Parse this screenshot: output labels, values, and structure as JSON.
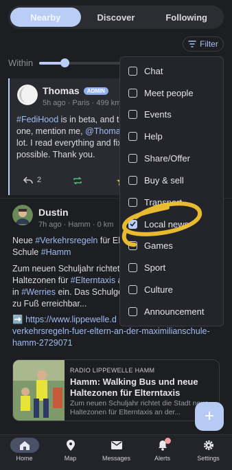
{
  "tabs": [
    {
      "label": "Nearby",
      "active": true
    },
    {
      "label": "Discover",
      "active": false
    },
    {
      "label": "Following",
      "active": false
    }
  ],
  "filter": {
    "label": "Filter"
  },
  "within": {
    "label": "Within",
    "slider_value_fraction": 0.3
  },
  "post1": {
    "author": "Thomas",
    "badge": "ADMIN",
    "meta": "5h ago · Paris · 499 km",
    "line1_tag": "#FediHood",
    "line1_rest": " is in beta, and th",
    "line2_pre": "one, mention me, ",
    "line2_mention": "@Thomas",
    "line3": "lot. I read everything and fix",
    "line4": "possible. Thank you.",
    "replies": "2"
  },
  "post2": {
    "author": "Dustin",
    "meta": "7h ago · Hamm · 0 km",
    "p1_a": "Neue ",
    "p1_tag": "#Verkehrsregeln",
    "p1_b": " für El",
    "p1_c": "Schule ",
    "p1_tag2": "#Hamm",
    "p2_a": "Zum neuen Schuljahr richtet",
    "p2_b": "Haltezonen für ",
    "p2_tag": "#Elterntaxis",
    "p2_c": " a",
    "p2_d": "in ",
    "p2_tag2": "#Werries",
    "p2_e": " ein. Das Schulge",
    "p2_f": "zu Fuß erreichbar...",
    "link_prefix": "➡️",
    "link_line1": "https://www.lippewelle.d",
    "link_line2": "verkehrsregeln-fuer-eltern-an-der-maximilianschule-",
    "link_line3": "hamm-2729071"
  },
  "link_preview": {
    "source": "RADIO LIPPEWELLE HAMM",
    "title": "Hamm: Walking Bus und neue Haltezonen für Elterntaxis",
    "desc": "Zum neuen Schuljahr richtet die Stadt neue Haltezonen für Elterntaxis an der..."
  },
  "fab": {
    "symbol": "+"
  },
  "filter_menu": {
    "items": [
      {
        "label": "Chat",
        "checked": false
      },
      {
        "label": "Meet people",
        "checked": false
      },
      {
        "label": "Events",
        "checked": false
      },
      {
        "label": "Help",
        "checked": false
      },
      {
        "label": "Share/Offer",
        "checked": false
      },
      {
        "label": "Buy & sell",
        "checked": false
      },
      {
        "label": "Transport",
        "checked": false
      },
      {
        "label": "Local news",
        "checked": true
      },
      {
        "label": "Games",
        "checked": false
      },
      {
        "label": "Sport",
        "checked": false
      },
      {
        "label": "Culture",
        "checked": false
      },
      {
        "label": "Announcement",
        "checked": false
      }
    ]
  },
  "bottom_nav": [
    {
      "label": "Home",
      "icon": "home-icon",
      "active": true
    },
    {
      "label": "Map",
      "icon": "map-pin-icon",
      "active": false
    },
    {
      "label": "Messages",
      "icon": "mail-icon",
      "active": false
    },
    {
      "label": "Alerts",
      "icon": "bell-icon",
      "active": false
    },
    {
      "label": "Settings",
      "icon": "gear-icon",
      "active": false
    }
  ],
  "colors": {
    "accent": "#b9cdf6",
    "highlight": "#f2c230",
    "background": "#1d1e22"
  }
}
